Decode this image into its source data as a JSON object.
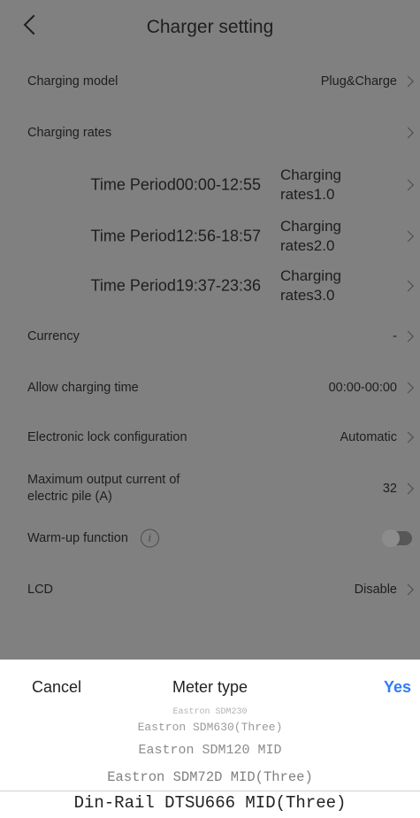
{
  "nav": {
    "title": "Charger setting"
  },
  "settings": {
    "charging_model": {
      "label": "Charging model",
      "value": "Plug&Charge"
    },
    "charging_rates": {
      "label": "Charging rates"
    },
    "periods": [
      {
        "label": "Time Period00:00-12:55",
        "rate_line1": "Charging",
        "rate_line2": "rates1.0"
      },
      {
        "label": "Time Period12:56-18:57",
        "rate_line1": "Charging",
        "rate_line2": "rates2.0"
      },
      {
        "label": "Time Period19:37-23:36",
        "rate_line1": "Charging",
        "rate_line2": "rates3.0"
      }
    ],
    "currency": {
      "label": "Currency",
      "value": "-"
    },
    "allow_time": {
      "label": "Allow charging time",
      "value": "00:00-00:00"
    },
    "lock": {
      "label": "Electronic lock configuration",
      "value": "Automatic"
    },
    "max_current": {
      "label_line1": "Maximum output current of",
      "label_line2": "electric pile (A)",
      "value": "32"
    },
    "warmup": {
      "label": "Warm-up function",
      "icon_text": "i",
      "enabled": false
    },
    "lcd": {
      "label": "LCD",
      "value": "Disable"
    }
  },
  "picker": {
    "cancel_label": "Cancel",
    "title": "Meter type",
    "yes_label": "Yes",
    "options": [
      "Eastron SDM230",
      "Eastron SDM630(Three)",
      "Eastron SDM120 MID",
      "Eastron SDM72D MID(Three)",
      "Din-Rail DTSU666 MID(Three)"
    ],
    "selected": "Din-Rail DTSU666 MID(Three)"
  }
}
